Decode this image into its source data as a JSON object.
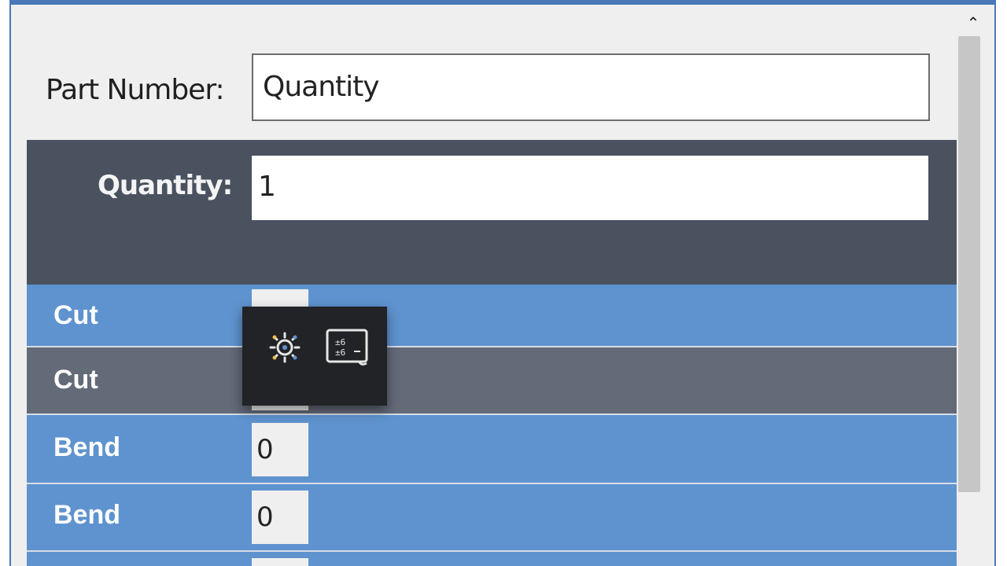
{
  "form": {
    "part_number_label": "Part Number:",
    "part_number_value": "Quantity",
    "quantity_label": "Quantity:",
    "quantity_value": "1"
  },
  "operations": [
    {
      "label": "Cut",
      "value": "",
      "style": "blue"
    },
    {
      "label": "Cut",
      "value": "",
      "style": "grey"
    },
    {
      "label": "Bend",
      "value": "0",
      "style": "blue"
    },
    {
      "label": "Bend",
      "value": "0",
      "style": "blue"
    }
  ],
  "popup": {
    "icons": [
      "settings-gear-icon",
      "calculator-panel-icon"
    ]
  },
  "scrollbar": {
    "up_glyph": "⌃"
  },
  "colors": {
    "window_border": "#4a78b8",
    "dark_band": "#4a5260",
    "row_blue": "#5f93cf",
    "row_grey": "#636a78",
    "popup_bg": "#222326"
  }
}
